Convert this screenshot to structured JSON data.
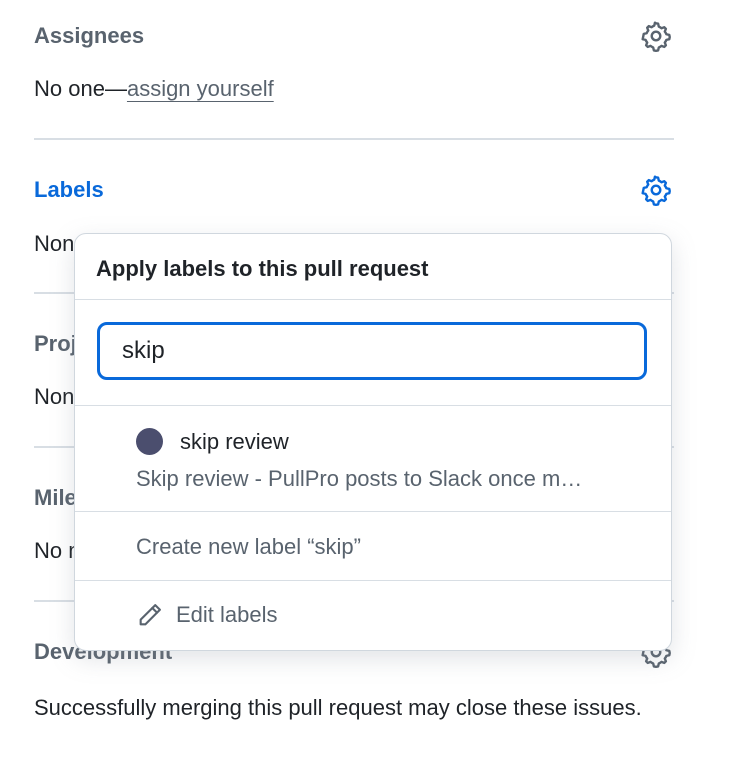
{
  "sidebar": {
    "assignees": {
      "title": "Assignees",
      "prefix": "No one—",
      "link": "assign yourself",
      "icon": "gear-icon"
    },
    "labels": {
      "title": "Labels",
      "value": "None yet",
      "icon": "gear-icon"
    },
    "projects": {
      "title": "Projects",
      "value": "None yet"
    },
    "milestone": {
      "title": "Milestone",
      "value": "No milestone"
    },
    "development": {
      "title": "Development",
      "body": "Successfully merging this pull request may close these issues.",
      "icon": "gear-icon"
    }
  },
  "popover": {
    "title": "Apply labels to this pull request",
    "search_value": "skip",
    "results": [
      {
        "name": "skip review",
        "description": "Skip review - PullPro posts to Slack once m…",
        "color": "#4b4e6e"
      }
    ],
    "create_label": "Create new label “skip”",
    "edit_labels": "Edit labels",
    "edit_icon": "pencil-icon"
  },
  "colors": {
    "accent": "#0969da",
    "muted_text": "#59636e",
    "border": "#d0d7de"
  }
}
